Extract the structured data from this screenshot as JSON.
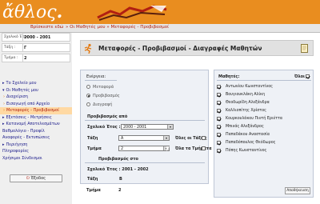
{
  "header": {
    "logo_text": "ἄθλος",
    "you_are_here_label": "Βρίσκεστε εδώ",
    "breadcrumb_path": "» Οι Μαθητές μου » Μεταφορές - Προβιβασμοί",
    "bg_color": "#e98d1f"
  },
  "sidebar": {
    "info": [
      {
        "key": "Σχολικό Έτος :",
        "value": "2000 - 2001"
      },
      {
        "key": "Τάξη :",
        "value": "Γ"
      },
      {
        "key": "Τμήμα :",
        "value": "2"
      }
    ],
    "menu": [
      {
        "label": "Το Σχολείο μου",
        "sub": false,
        "selected": false
      },
      {
        "label": "Οι Μαθητές μου",
        "sub": false,
        "selected": false
      },
      {
        "label": "Διαχείριση",
        "sub": true,
        "selected": false
      },
      {
        "label": "Εισαγωγή από Αρχείο",
        "sub": true,
        "selected": false
      },
      {
        "label": "Μεταφορές - Προβιβασμοί",
        "sub": true,
        "selected": true
      },
      {
        "label": "Εξετάσεις - Μετρήσεις",
        "sub": false,
        "selected": false
      },
      {
        "label": "Κατανομή Αποτελεσμάτων",
        "sub": false,
        "selected": false
      },
      {
        "label": "Βαθμολόγιο - Προφίλ",
        "sub": false,
        "selected": false,
        "plain": true
      },
      {
        "label": "Αναφορές - Εκτυπώσεις",
        "sub": false,
        "selected": false,
        "plain": true
      },
      {
        "label": "Περιήγηση",
        "sub": false,
        "selected": false
      },
      {
        "label": "Πληροφορίες",
        "sub": false,
        "selected": false,
        "plain": true
      },
      {
        "label": "Χρήσιμοι Σύνδεσμοι",
        "sub": false,
        "selected": false,
        "plain": true
      }
    ],
    "exit_label": "Έξοδος"
  },
  "main": {
    "title": "Μεταφορές - Προβιβασμοί - Διαγραφές Μαθητών",
    "action_label": "Ενέργεια:",
    "actions": [
      {
        "label": "Μεταφορά",
        "selected": false
      },
      {
        "label": "Προβιβασμός",
        "selected": true
      },
      {
        "label": "Διαγραφή",
        "selected": false
      }
    ],
    "from_heading": "Προβιβασμός από",
    "school_year_label": "Σχολικό Έτος :",
    "school_year_value": "2000 - 2001",
    "class_label": "Τάξη",
    "class_value": "Α",
    "all_classes_label": "Όλες οι Τάξεις",
    "section_label": "Τμήμα",
    "section_value": "2",
    "all_sections_label": "Όλα τα Τμήματα",
    "to_heading": "Προβιβασμός στο",
    "to_school_year_label": "Σχολικό Έτος : 2001 - 2002",
    "to_class_label": "Τάξη",
    "to_class_value": "Β",
    "to_section_label": "Τμήμα",
    "to_section_value": "2"
  },
  "students": {
    "heading": "Μαθητές:",
    "all_label": "Όλοι",
    "list": [
      "Αντωνίου Κωνσταντίνος",
      "Βουγιουκλάκη Αλίκη",
      "Θεοδωρίδη Αλεξάνδρα",
      "Καλλιοπίτης Χρίστος",
      "Κουρκουλάκου Πιντή Εριέττα",
      "Μπινάς Αλεξάνδρος",
      "Παπαδάκου Αναστασία",
      "Παπαδόπουλος Θεόδωρος",
      "Πόπης Κωνσταντίνος"
    ],
    "button_label": "Αποθήκευση"
  }
}
